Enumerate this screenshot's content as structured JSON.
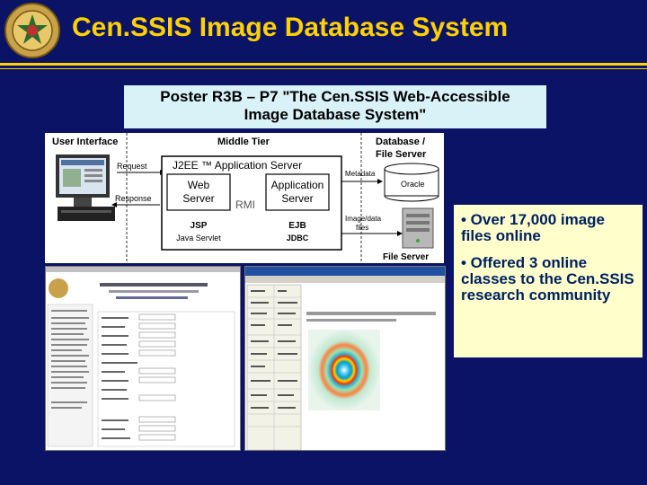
{
  "slide": {
    "title": "Cen.SSIS Image Database System",
    "poster_line1": "Poster R3B – P7 \"The Cen.SSIS Web-Accessible",
    "poster_line2": "Image Database System\"",
    "bullets": [
      "• Over 17,000 image files online",
      "• Offered 3 online classes to the Cen.SSIS research community"
    ]
  },
  "diagram": {
    "user_interface": "User Interface",
    "middle_tier": "Middle Tier",
    "database_line1": "Database /",
    "database_line2": "File Server",
    "request": "Request",
    "response": "Response",
    "app_server": "J2EE ™ Application Server",
    "web_server_line1": "Web",
    "web_server_line2": "Server",
    "rmi": "RMI",
    "application_line1": "Application",
    "application_line2": "Server",
    "jsp": "JSP",
    "java_servlet": "Java Servlet",
    "ejb": "EJB",
    "jdbc": "JDBC",
    "metadata": "Metadata",
    "oracle": "Oracle",
    "image_data_line1": "Image/data",
    "image_data_line2": "files",
    "file_server": "File Server"
  },
  "colors": {
    "background": "#0b1366",
    "title": "#ffd100",
    "poster_box": "#d8f2f8",
    "bullet_box": "#ffffcc",
    "bullet_text": "#002060"
  },
  "icons": [
    "cen-ssis-logo-icon",
    "computer-monitor-icon",
    "database-cylinder-icon",
    "server-tower-icon"
  ]
}
